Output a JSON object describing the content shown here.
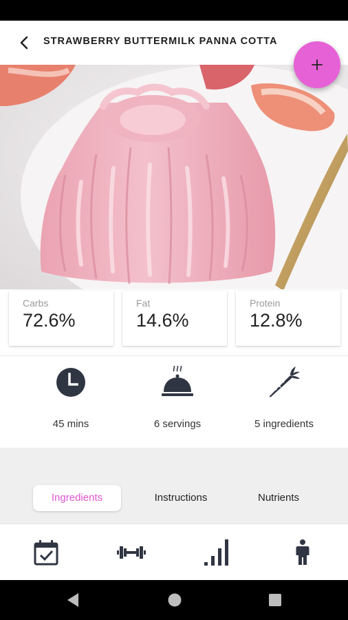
{
  "header": {
    "title": "STRAWBERRY BUTTERMILK PANNA COTTA"
  },
  "icons": {
    "back": "chevron-left-icon",
    "add": "plus-icon",
    "time": "clock-icon",
    "servings": "serving-cloche-icon",
    "ingredients": "carrot-icon"
  },
  "colors": {
    "accent": "#e661d6",
    "tab_active_text": "#e054d0",
    "dark_icon": "#2f3542"
  },
  "macros": [
    {
      "label": "Carbs",
      "value": "72.6%"
    },
    {
      "label": "Fat",
      "value": "14.6%"
    },
    {
      "label": "Protein",
      "value": "12.8%"
    }
  ],
  "info": {
    "time": "45 mins",
    "servings": "6 servings",
    "ingredients": "5 ingredients"
  },
  "tabs": [
    {
      "label": "Ingredients",
      "active": true
    },
    {
      "label": "Instructions",
      "active": false
    },
    {
      "label": "Nutrients",
      "active": false
    }
  ],
  "bottom_nav": [
    "calendar-check-icon",
    "dumbbell-icon",
    "bar-chart-icon",
    "person-icon"
  ]
}
